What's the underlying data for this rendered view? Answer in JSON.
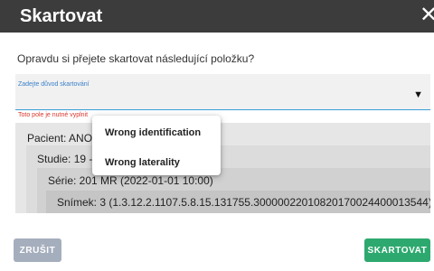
{
  "dialog": {
    "title": "Skartovat",
    "close_glyph": "✕",
    "question": "Opravdu si přejete skartovat následující položku?"
  },
  "reason_field": {
    "label": "Zadejte důvod skartování",
    "value": "",
    "arrow_glyph": "▼",
    "error": "Toto pole je nutné vyplnit"
  },
  "dropdown": {
    "options": [
      "Wrong identification",
      "Wrong laterality"
    ]
  },
  "tree": {
    "patient": "Pacient: ANON",
    "study": "Studie: 19 - M",
    "series": "Série: 201 MR (2022-01-01 10:00)",
    "image": "Snímek: 3 (1.3.12.2.1107.5.8.15.131755.30000022010820170024400013544)"
  },
  "buttons": {
    "cancel": "ZRUŠIT",
    "confirm": "SKARTOVAT"
  },
  "colors": {
    "titlebar": "#3c3c3c",
    "accent_blue": "#3a9ed8",
    "error_red": "#d9362b",
    "confirm_green": "#2da96f",
    "cancel_gray": "#a5aebd"
  }
}
